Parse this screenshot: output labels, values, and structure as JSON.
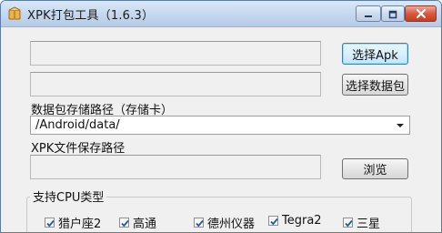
{
  "window": {
    "title": "XPK打包工具（1.6.3）",
    "icon": "app-package-icon",
    "controls": {
      "minimize": "minimize-icon",
      "maximize": "maximize-icon",
      "close": "close-icon"
    }
  },
  "apk": {
    "value": "",
    "button_label": "选择Apk"
  },
  "data_package": {
    "value": "",
    "button_label": "选择数据包"
  },
  "storage_path": {
    "label": "数据包存储路径（存储卡）",
    "selected": "/Android/data/"
  },
  "xpk_save": {
    "label": "XPK文件保存路径",
    "value": "",
    "button_label": "浏览"
  },
  "cpu_group": {
    "legend": "支持CPU类型",
    "options": [
      {
        "label": "猎户座2",
        "checked": true
      },
      {
        "label": "高通",
        "checked": true
      },
      {
        "label": "德州仪器",
        "checked": true
      },
      {
        "label": "Tegra2",
        "checked": true
      },
      {
        "label": "三星",
        "checked": true
      }
    ]
  },
  "colors": {
    "titlebar": "#c2d6ee",
    "close_button": "#d9583f",
    "focus_button": "#3c7fb1",
    "checkmark": "#2b5a8a"
  }
}
